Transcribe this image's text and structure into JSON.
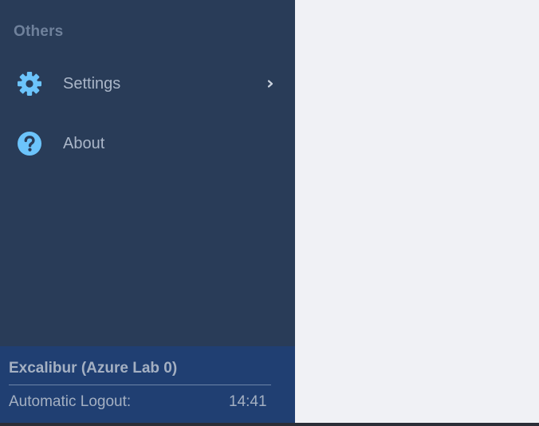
{
  "sidebar": {
    "section_title": "Others",
    "items": [
      {
        "label": "Settings",
        "icon": "gear-icon",
        "has_submenu": true
      },
      {
        "label": "About",
        "icon": "help-circle-icon",
        "has_submenu": false
      }
    ]
  },
  "footer": {
    "instance_name": "Excalibur (Azure Lab 0)",
    "logout_label": "Automatic Logout:",
    "logout_time": "14:41"
  },
  "colors": {
    "sidebar_bg": "#293c58",
    "footer_bg": "#203f72",
    "icon_accent": "#6cc4fb",
    "main_bg": "#f0f1f5"
  }
}
